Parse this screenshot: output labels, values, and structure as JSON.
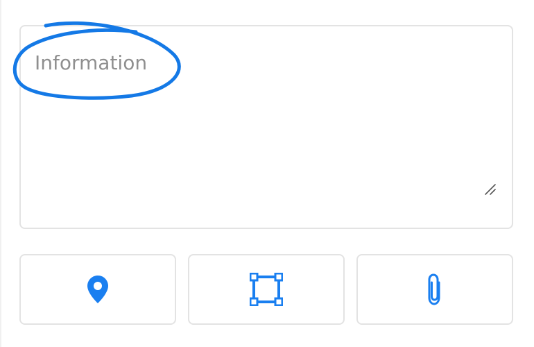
{
  "information_field": {
    "placeholder": "Information",
    "value": ""
  },
  "actions": [
    {
      "icon": "location-pin-icon"
    },
    {
      "icon": "select-area-icon"
    },
    {
      "icon": "paperclip-icon"
    }
  ],
  "colors": {
    "accent": "#1a7ff0",
    "border": "#e3e3e3",
    "placeholder": "#8f8f8f",
    "annotation": "#1479e6"
  }
}
